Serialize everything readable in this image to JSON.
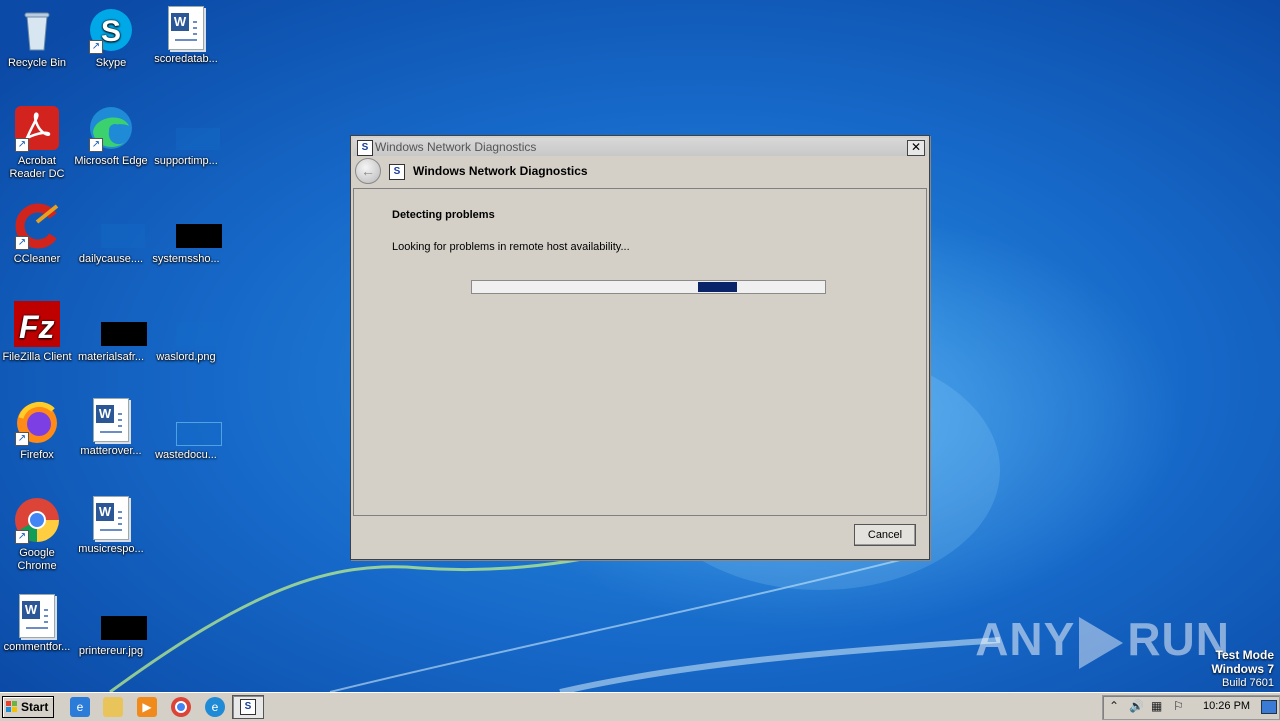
{
  "desktop": {
    "icons": [
      {
        "label": "Recycle Bin",
        "icon": "recycle-bin-icon"
      },
      {
        "label": "Skype",
        "icon": "skype-icon"
      },
      {
        "label": "scoredatab...",
        "icon": "word-document-icon"
      },
      {
        "label": "Acrobat Reader DC",
        "icon": "acrobat-reader-icon"
      },
      {
        "label": "Microsoft Edge",
        "icon": "edge-icon"
      },
      {
        "label": "supportimp...",
        "icon": "image-file-icon"
      },
      {
        "label": "CCleaner",
        "icon": "ccleaner-icon"
      },
      {
        "label": "dailycause....",
        "icon": "image-file-icon"
      },
      {
        "label": "systemssho...",
        "icon": "image-file-icon"
      },
      {
        "label": "FileZilla Client",
        "icon": "filezilla-icon"
      },
      {
        "label": "materialsafr...",
        "icon": "image-file-icon"
      },
      {
        "label": "waslord.png",
        "icon": "image-file-icon"
      },
      {
        "label": "Firefox",
        "icon": "firefox-icon"
      },
      {
        "label": "matterover...",
        "icon": "word-document-icon"
      },
      {
        "label": "wastedocu...",
        "icon": "image-file-icon"
      },
      {
        "label": "Google Chrome",
        "icon": "chrome-icon"
      },
      {
        "label": "musicrespo...",
        "icon": "word-document-icon"
      },
      {
        "label": "commentfor...",
        "icon": "word-document-icon"
      },
      {
        "label": "printereur.jpg",
        "icon": "image-file-icon"
      }
    ]
  },
  "dialog": {
    "title": "Windows Network Diagnostics",
    "header_title": "Windows Network Diagnostics",
    "close_glyph": "✕",
    "heading": "Detecting problems",
    "status_text": "Looking for problems in remote host availability...",
    "progress": {
      "marquee_start_fraction": 0.64,
      "marquee_width_fraction": 0.11
    },
    "cancel_label": "Cancel"
  },
  "watermark": {
    "left": "ANY",
    "right": "RUN"
  },
  "test_mode": {
    "line1": "Test Mode",
    "line2": "Windows 7",
    "line3": "Build 7601"
  },
  "taskbar": {
    "start_label": "Start",
    "pinned": [
      "internet-explorer-icon",
      "explorer-folder-icon",
      "media-player-icon",
      "chrome-icon",
      "edge-icon",
      "network-diagnostics-icon"
    ],
    "clock": "10:26 PM"
  },
  "colors": {
    "progress_fill": "#0a246a",
    "dialog_bg": "#d4d0c8"
  }
}
